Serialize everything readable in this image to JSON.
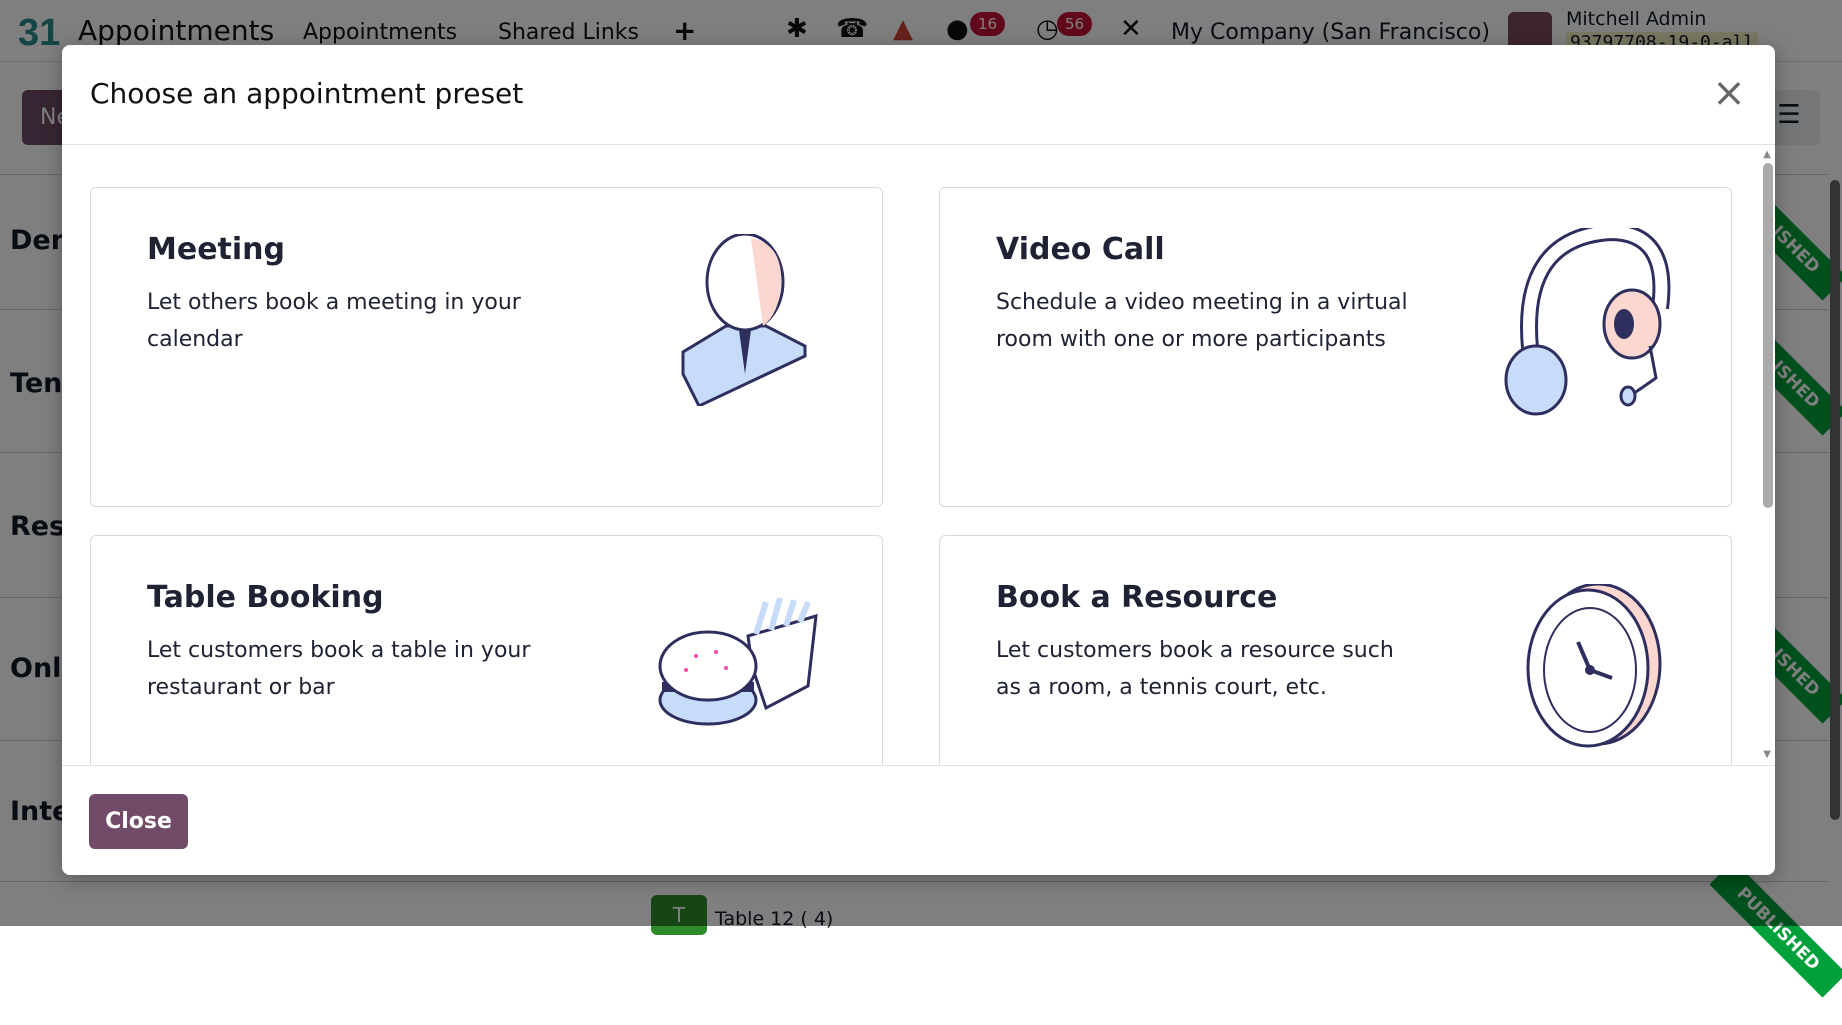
{
  "navbar": {
    "logo": "31",
    "app_name": "Appointments",
    "menu": [
      "Appointments",
      "Shared Links"
    ],
    "plus": "+",
    "messages_count": "16",
    "activities_count": "56",
    "company": "My Company (San Francisco)",
    "user_name": "Mitchell Admin",
    "database": "93797708-19-0-all"
  },
  "page": {
    "new_button": "New",
    "rows": [
      "Demo",
      "Tennis",
      "Restaurant",
      "Online",
      "Interview"
    ],
    "ribbon": "PUBLISHED",
    "table_chip": "T",
    "table_text": "Table 12 ( 4)"
  },
  "modal": {
    "title": "Choose an appointment preset",
    "close_icon": "×",
    "cards": [
      {
        "title": "Meeting",
        "description": "Let others book a meeting in your calendar"
      },
      {
        "title": "Video Call",
        "description": "Schedule a video meeting in a virtual room with one or more participants"
      },
      {
        "title": "Table Booking",
        "description": "Let customers book a table in your restaurant or bar"
      },
      {
        "title": "Book a Resource",
        "description": "Let customers book a resource such as a room, a tennis court, etc."
      }
    ],
    "close_button": "Close"
  },
  "colors": {
    "primary": "#714b67",
    "ribbon": "#00a13a",
    "badge": "#c4113a"
  }
}
